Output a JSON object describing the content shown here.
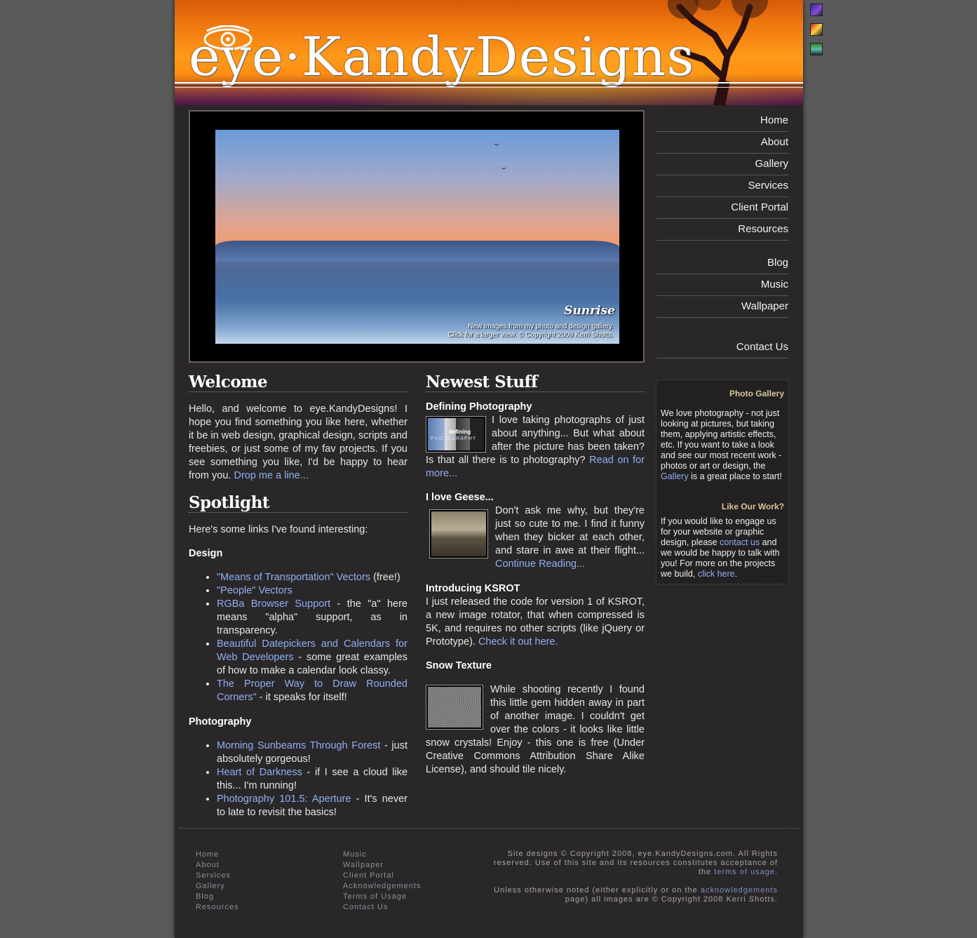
{
  "header": {
    "logo_text": "eye·KandyDesigns"
  },
  "slideshow": {
    "caption_title": "Sunrise",
    "caption_line1": "New images from my photo and design gallery.",
    "caption_line2": "Click for a larger view. © Copyright 2009 Kerri Shotts."
  },
  "nav": {
    "home": "Home",
    "about": "About",
    "gallery": "Gallery",
    "services": "Services",
    "client_portal": "Client Portal",
    "resources": "Resources",
    "blog": "Blog",
    "music": "Music",
    "wallpaper": "Wallpaper",
    "contact": "Contact Us"
  },
  "sidebox": {
    "title1": "Photo Gallery",
    "text1_a": "We love photography - not just looking at pictures, but taking them, applying artistic effects, etc. If you want to take a look and see our most recent work - photos or art or design, the",
    "text1_link": "Gallery",
    "text1_b": "is a great place to start!",
    "title2": "Like Our Work?",
    "text2_a": "If you would like to engage us for your website or graphic design, please",
    "text2_link1": "contact us",
    "text2_b": "and we would be happy to talk with you! For more on the projects we build,",
    "text2_link2": "click here",
    "text2_c": "."
  },
  "welcome": {
    "heading": "Welcome",
    "text": "Hello, and welcome to eye.KandyDesigns! I hope you find something you like here, whether it be in web design, graphical design, scripts and freebies, or just some of my fav projects. If you see something you like, I'd be happy to hear from you.",
    "link": "Drop me a line..."
  },
  "spotlight": {
    "heading": "Spotlight",
    "intro": "Here's some links I've found interesting:",
    "design_label": "Design",
    "design": [
      {
        "link": "\"Means of Transportation\" Vectors",
        "rest": " (free!)"
      },
      {
        "link": "\"People\" Vectors",
        "rest": ""
      },
      {
        "link": "RGBa Browser Support",
        "rest": " - the \"a\" here means \"alpha\" support, as in transparency."
      },
      {
        "link": "Beautiful Datepickers and Calendars for Web Developers",
        "rest": " - some great examples of how to make a calendar look classy."
      },
      {
        "link": "The Proper Way to Draw Rounded Corners\"",
        "rest": " - it speaks for itself!"
      }
    ],
    "photo_label": "Photography",
    "photo": [
      {
        "link": "Morning Sunbeams Through Forest",
        "rest": " - just absolutely gorgeous!"
      },
      {
        "link": "Heart of Darkness",
        "rest": " - if I see a cloud like this... I'm running!"
      },
      {
        "link": "Photography 101.5: Aperture",
        "rest": " - It's never to late to revisit the basics!"
      }
    ]
  },
  "newest": {
    "heading": "Newest Stuff",
    "items": [
      {
        "title": "Defining Photography",
        "text": "I love taking photographs of just about anything... But what about after the picture has been taken? Is that all there is to photography?",
        "link": "Read on for more..."
      },
      {
        "title": "I love Geese...",
        "text": "Don't ask me why, but they're just so cute to me. I find it funny when they bicker at each other, and stare in awe at their flight...",
        "link": "Continue Reading..."
      },
      {
        "title": "Introducing KSROT",
        "text": "I just released the code for version 1 of KSROT, a new image rotator, that when compressed is 5K, and requires no other scripts (like jQuery or Prototype).",
        "link": "Check it out here."
      },
      {
        "title": "Snow Texture",
        "text": "While shooting recently I found this little gem hidden away in part of another image. I couldn't get over the colors - it looks like little snow crystals! Enjoy - this one is free (Under Creative Commons Attribution Share Alike License), and should tile nicely.",
        "link": ""
      }
    ],
    "thumb1_text1": "defining",
    "thumb1_text2": "PHOTOGRAPHY"
  },
  "footer": {
    "col1": [
      "Home",
      "About",
      "Services",
      "Gallery",
      "Blog",
      "Resources"
    ],
    "col2": [
      "Music",
      "Wallpaper",
      "Client Portal",
      "Acknowledgements",
      "Terms of Usage",
      "Contact Us"
    ],
    "legal1": "Site designs © Copyright 2008, eye.KandyDesigns.com. All Rights reserved. Use of this site and its resources constitutes acceptance of the",
    "legal1_link": "terms of usage",
    "legal1_end": ".",
    "legal2_a": "Unless otherwise noted (either explicitly or on the",
    "legal2_link": "acknowledgements",
    "legal2_b": "page) all images are © Copyright 2008 Kerri Shotts."
  }
}
